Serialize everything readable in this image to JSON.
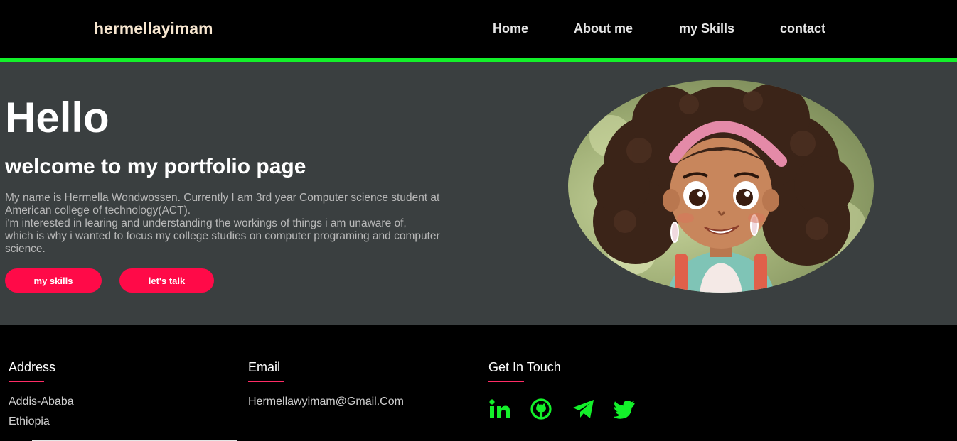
{
  "header": {
    "logo": "hermellayimam",
    "nav": [
      "Home",
      "About me",
      "my Skills",
      "contact"
    ]
  },
  "hero": {
    "greeting": "Hello",
    "subtitle": "welcome to my portfolio page",
    "bio_lines": [
      "My name is Hermella Wondwossen. Currently I am 3rd year Computer science student at",
      "American college of technology(ACT).",
      "i'm interested in learing and understanding the workings of things i am unaware of,",
      "which is why i wanted to focus my college studies on computer programing and computer",
      "science."
    ],
    "buttons": [
      "my skills",
      "let's talk"
    ]
  },
  "footer": {
    "address_title": "Address",
    "address_lines": [
      "Addis-Ababa",
      "Ethiopia"
    ],
    "email_title": "Email",
    "email": "Hermellawyimam@Gmail.Com",
    "contact_title": "Get In Touch",
    "social_icons": [
      "linkedin-icon",
      "github-icon",
      "telegram-icon",
      "twitter-icon"
    ]
  },
  "colors": {
    "accent_green": "#13f12a",
    "button_red": "#ff0a48",
    "hero_bg": "#3a3f40"
  }
}
